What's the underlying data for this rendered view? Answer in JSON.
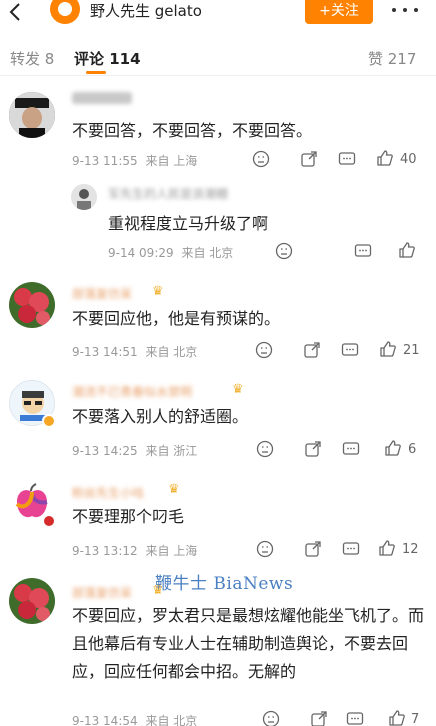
{
  "header": {
    "account_name": "野人先生 gelato",
    "follow_label": "+关注"
  },
  "tabs": {
    "repost": "转发 8",
    "comment": "评论 114",
    "like": "赞 217"
  },
  "comments": [
    {
      "name": "",
      "text": "不要回答，不要回答，不要回答。",
      "date": "9-13 11:55",
      "source": "来自 上海",
      "likes": "40",
      "reply": {
        "name": "军先生的人民是浪潮棚",
        "text": "重视程度立马升级了啊",
        "date": "9-14 09:29",
        "source": "来自 北京"
      }
    },
    {
      "name": "部落复仿呆",
      "text": "不要回应他，他是有预谋的。",
      "date": "9-13 14:51",
      "source": "来自 北京",
      "likes": "21"
    },
    {
      "name": "潮流不已青春似水禁明",
      "text": "不要落入别人的舒适圈。",
      "date": "9-13 14:25",
      "source": "来自 浙江",
      "likes": "6"
    },
    {
      "name": "粉丝先生小咕",
      "text": "不要理那个叼毛",
      "date": "9-13 13:12",
      "source": "来自 上海",
      "likes": "12"
    },
    {
      "name": "部落复仿呆",
      "text": "不要回应，罗太君只是最想炫耀他能坐飞机了。而且他幕后有专业人士在辅助制造舆论，不要去回应，回应任何都会中招。无解的",
      "date": "9-13 14:54",
      "source": "来自 北京",
      "likes": "7"
    }
  ],
  "watermark": "鞭牛士 BiaNews",
  "colors": {
    "accent": "#ff8200",
    "meta_gray": "#999999",
    "watermark_blue": "#4a7fc1"
  }
}
